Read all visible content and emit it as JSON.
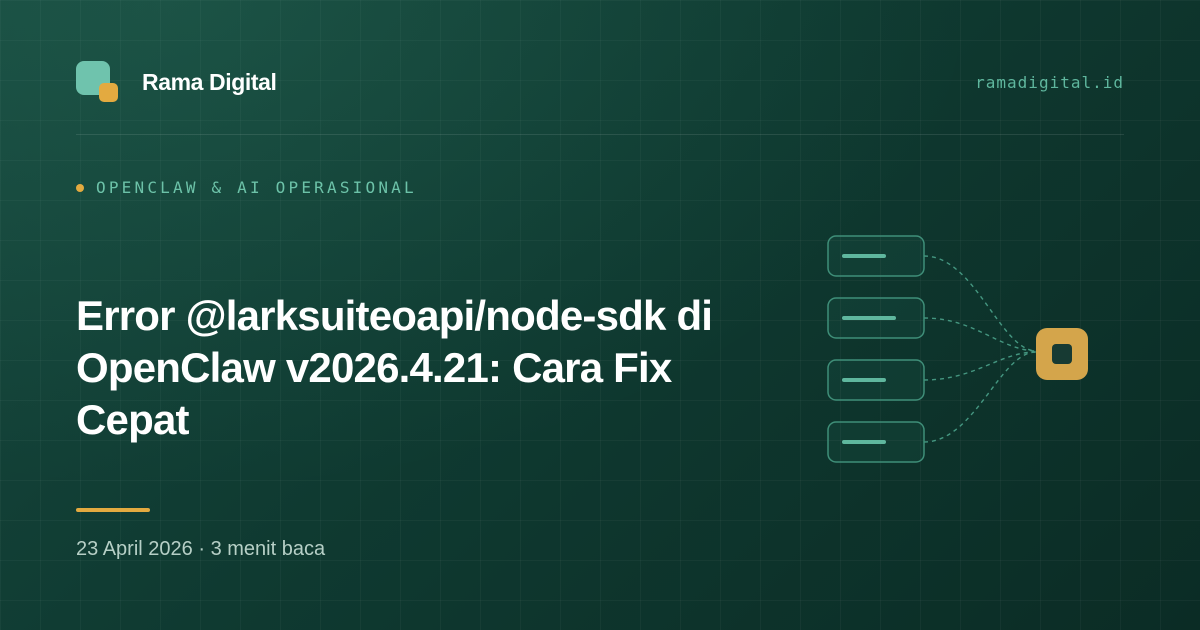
{
  "brand": {
    "name": "Rama Digital",
    "domain": "ramadigital.id",
    "logo_icon": "rounded-squares-logo-icon",
    "colors": {
      "primary": "#6fc3ad",
      "accent": "#e3aa40",
      "background": "#0f3a31"
    }
  },
  "category": {
    "label": "OPENCLAW & AI OPERASIONAL",
    "dot_icon": "amber-dot-icon"
  },
  "article": {
    "title_lines": [
      "Error @larksuiteoapi/node-sdk di",
      "OpenClaw v2026.4.21: Cara Fix",
      "Cepat"
    ],
    "date": "23 April 2026",
    "separator": "·",
    "read_time": "3 menit baca"
  },
  "illustration": {
    "icon": "nodes-converging-diagram-icon",
    "source_node_count": 4,
    "target_icon": "hub-node-icon"
  }
}
